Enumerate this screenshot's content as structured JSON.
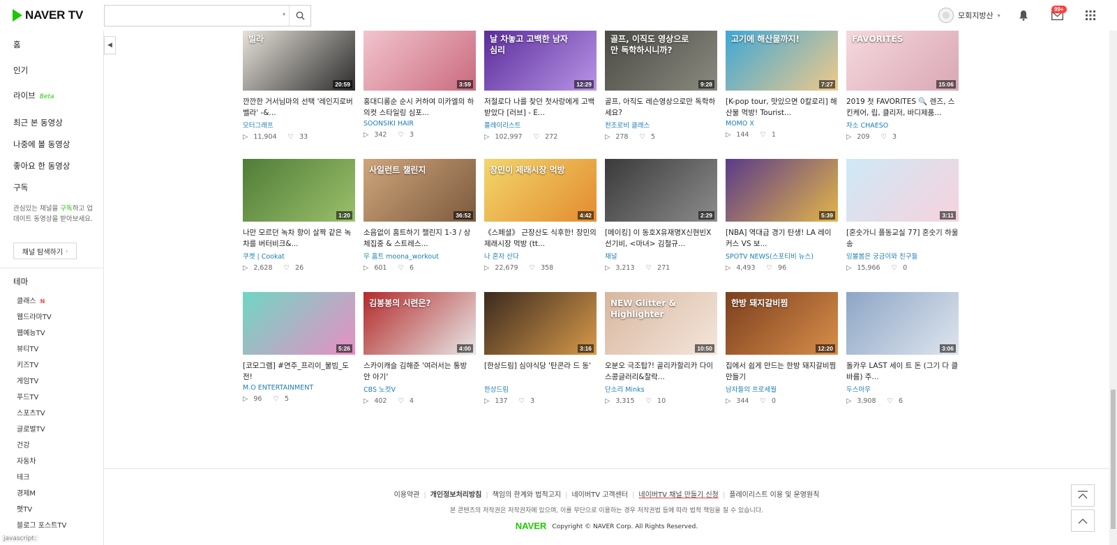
{
  "header": {
    "logo_text": "NAVER TV",
    "search_placeholder": "",
    "user_name": "모회지방산",
    "mail_badge": "99+"
  },
  "sidebar": {
    "nav": [
      {
        "label": "홈"
      },
      {
        "label": "인기"
      },
      {
        "label": "라이브",
        "tag": "Beta"
      },
      {
        "label": "최근 본 동영상"
      },
      {
        "label": "나중에 볼 동영상"
      },
      {
        "label": "좋아요 한 동영상"
      },
      {
        "label": "구독"
      }
    ],
    "subscribe_desc_pre": "관심있는 채널을 ",
    "subscribe_desc_hl": "구독",
    "subscribe_desc_post": "하고 업데이트 동영상을 받아보세요.",
    "channel_btn": "채널 탐색하기",
    "theme_heading": "테마",
    "themes": [
      {
        "label": "클래스",
        "new": "N"
      },
      {
        "label": "웹드라마TV"
      },
      {
        "label": "웹예능TV"
      },
      {
        "label": "뷰티TV"
      },
      {
        "label": "키즈TV"
      },
      {
        "label": "게임TV"
      },
      {
        "label": "푸드TV"
      },
      {
        "label": "스포츠TV"
      },
      {
        "label": "글로벌TV"
      },
      {
        "label": "건강"
      },
      {
        "label": "자동차"
      },
      {
        "label": "테크"
      },
      {
        "label": "경제M"
      },
      {
        "label": "펫TV"
      },
      {
        "label": "블로그 포스트TV"
      }
    ]
  },
  "videos": [
    {
      "title": "깐깐한 거서님마의 선택 '레인지로버 벨라' -&...",
      "channel": "모터그래프",
      "views": "11,904",
      "likes": "33",
      "duration": "20:59",
      "thumb_text": "빌라",
      "bg1": "#e9e4dc",
      "bg2": "#2c2c2c"
    },
    {
      "title": "홍대디롱순 순시 커하여 미카엘의 하의컷 스타일링 심포...",
      "channel": "SOONSIKI HAIR",
      "views": "342",
      "likes": "3",
      "duration": "3:59",
      "thumb_text": "",
      "bg1": "#f3c6cf",
      "bg2": "#c96a7e"
    },
    {
      "title": "저절로다 나를 찾던 첫사랑에게 고백 받았다 [러브] - E...",
      "channel": "플레이리스트",
      "views": "102,997",
      "likes": "272",
      "duration": "12:29",
      "thumb_text": "날 차놓고 고백한 남자 심리",
      "bg1": "#5a2b9a",
      "bg2": "#b895e6"
    },
    {
      "title": "골프, 아직도 레슨영상으로만 독학하세요?",
      "channel": "천조로비 클래스",
      "views": "278",
      "likes": "5",
      "duration": "9:28",
      "thumb_text": "골프, 이직도 영상으로만 독학하시니까?",
      "bg1": "#4a4a44",
      "bg2": "#8a8a80"
    },
    {
      "title": "[K-pop tour, 맛있으면 0칼로리] 해산물 먹방! Tourist...",
      "channel": "MOMO X",
      "views": "144",
      "likes": "1",
      "duration": "7:27",
      "thumb_text": "고기에 해산물까지!",
      "bg1": "#3ba7d8",
      "bg2": "#f0c98a"
    },
    {
      "title": "2019 첫 FAVORITES 🔍 렌즈, 스킨케어, 립, 클리저, 바디제품...",
      "channel": "차소 CHAESO",
      "views": "209",
      "likes": "3",
      "duration": "15:06",
      "thumb_text": "FAVORITES",
      "bg1": "#f6d9df",
      "bg2": "#d9a7b3"
    },
    {
      "title": "나만 모르던 녹차 향이 살짝 같은 녹차를 버터비크&...",
      "channel": "쿠켓 | Cookat",
      "views": "2,628",
      "likes": "26",
      "duration": "1:20",
      "thumb_text": "",
      "bg1": "#4f7d37",
      "bg2": "#9cc06b"
    },
    {
      "title": "소음없이 홈트하기 챌린지 1-3 / 상체집중 & 스트레스...",
      "channel": "무 홈트 moona_workout",
      "views": "601",
      "likes": "6",
      "duration": "36:52",
      "thumb_text": "사일런트 챌린지",
      "bg1": "#cfa57b",
      "bg2": "#7c5a3e"
    },
    {
      "title": "《스페셜》 근장산도 식후한! 장민의 제래시장 먹방 (tt...",
      "channel": "나 혼자 산다",
      "views": "22,679",
      "likes": "358",
      "duration": "4:42",
      "thumb_text": "장민이 제래시장 먹방",
      "bg1": "#f2d66b",
      "bg2": "#e38b2f"
    },
    {
      "title": "[메이킹] 이 동호X유재명X신현빈X선기비, <마녀> 김철규...",
      "channel": "채널",
      "views": "3,213",
      "likes": "271",
      "duration": "2:29",
      "thumb_text": "",
      "bg1": "#3a3a3a",
      "bg2": "#8c8c8c"
    },
    {
      "title": "[NBA] 역대급 경기 탄생! LA 레이커스 VS 보...",
      "channel": "SPOTV NEWS(스포티비 뉴스)",
      "views": "4,493",
      "likes": "96",
      "duration": "5:39",
      "thumb_text": "",
      "bg1": "#5b3a8a",
      "bg2": "#e3b54a"
    },
    {
      "title": "[혼숫가니 플동교실 77] 혼숫기 하울송",
      "channel": "잉볼봄은 궁금이와 친구들",
      "views": "15,966",
      "likes": "0",
      "duration": "3:11",
      "thumb_text": "",
      "bg1": "#cfe9f7",
      "bg2": "#f6d2dd"
    },
    {
      "title": "[코모그램] #연주_프리이_불빔_도전!",
      "channel": "M.O ENTERTAINMENT",
      "views": "96",
      "likes": "5",
      "duration": "5:26",
      "thumb_text": "",
      "bg1": "#6fd6c3",
      "bg2": "#e98ec4"
    },
    {
      "title": "스카이캐슬 김해준 '여러서는 통방 안 아기'",
      "channel": "CBS 노컷V",
      "views": "402",
      "likes": "4",
      "duration": "4:00",
      "thumb_text": "김봉봉의 시련은?",
      "bg1": "#b42a2a",
      "bg2": "#e8e8e8"
    },
    {
      "title": "[한상드림] 심야식당 '탄콘라 드 동'",
      "channel": "한상드림",
      "views": "137",
      "likes": "3",
      "duration": "3:16",
      "thumb_text": "",
      "bg1": "#3b2a1f",
      "bg2": "#d79a4a"
    },
    {
      "title": "오분오 극조탑?! 골리카할리카 다이스콩글러리&찰락...",
      "channel": "단소리 Minks",
      "views": "3,315",
      "likes": "10",
      "duration": "10:50",
      "thumb_text": "NEW Glitter & Highlighter",
      "bg1": "#d8b79f",
      "bg2": "#f4e6dc"
    },
    {
      "title": "집에서 쉽게 만드는 한방 돼지갈비찜 만들기",
      "channel": "남자들의 프로세월",
      "views": "344",
      "likes": "0",
      "duration": "12:20",
      "thumb_text": "한방 돼지갈비찜",
      "bg1": "#7b3f1e",
      "bg2": "#d98f4a"
    },
    {
      "title": "돌카우 LAST 세이 트 돈 (그기 다 클바름) 주...",
      "channel": "두스아우",
      "views": "3,908",
      "likes": "6",
      "duration": "3:06",
      "thumb_text": "",
      "bg1": "#8da6c6",
      "bg2": "#dfe5ee"
    }
  ],
  "footer": {
    "links": [
      "이용약관",
      "개인정보처리방침",
      "책임의 한계와 법적고지",
      "네이버TV 고객센터",
      "네이버TV 채널 만들기 신청",
      "플레이리스트 이용 및 운영원칙"
    ],
    "notice": "본 콘텐츠의 저작권은 저작권자에 있으며, 이를 무단으로 이용하는 경우 저작권법 등에 따라 법적 책임을 질 수 있습니다.",
    "brand": "NAVER",
    "copyright": "Copyright © NAVER Corp. All Rights Reserved."
  },
  "status_bar": "javascript:",
  "colors": {
    "accent": "#1ec800",
    "link": "#1a7db5",
    "badge": "#ff3e3e"
  }
}
